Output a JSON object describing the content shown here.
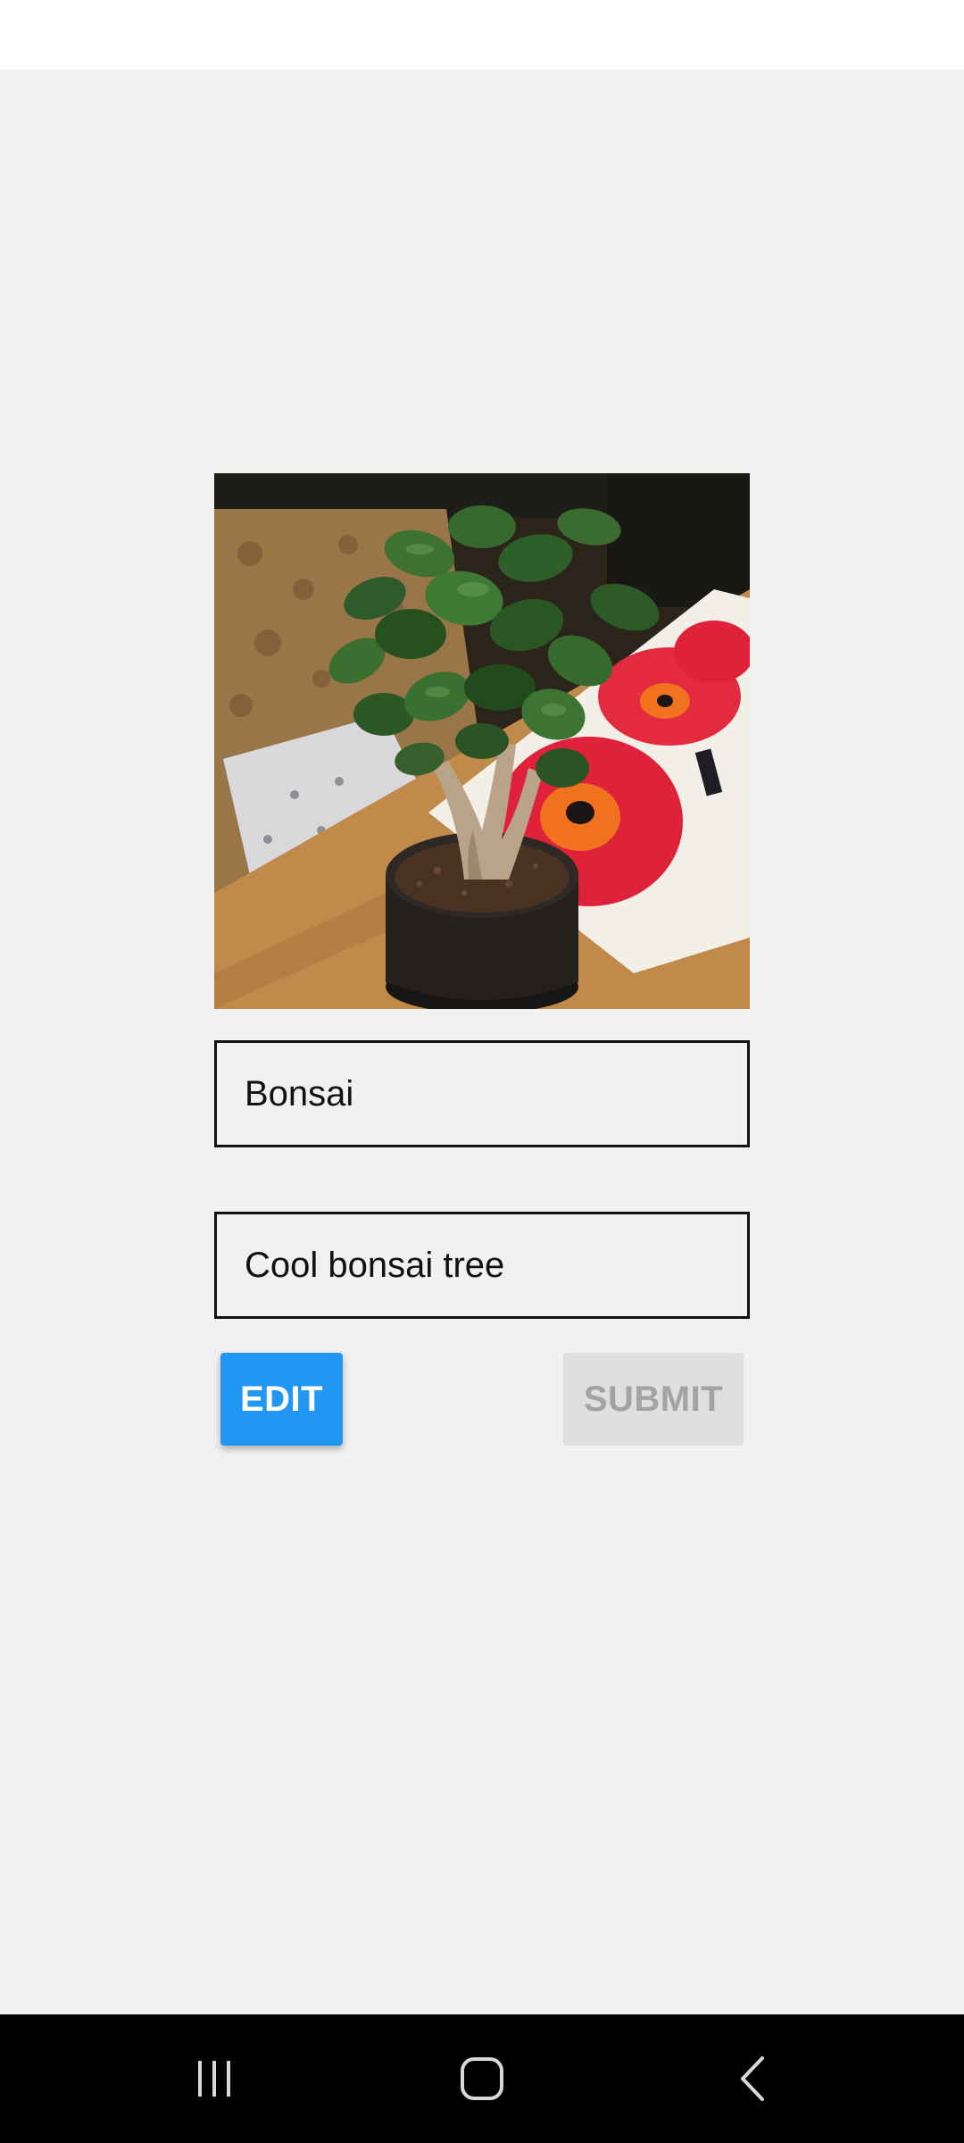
{
  "item": {
    "title_value": "Bonsai",
    "description_value": "Cool bonsai tree"
  },
  "actions": {
    "edit_label": "EDIT",
    "submit_label": "SUBMIT"
  },
  "colors": {
    "edit_button": "#2196f3",
    "submit_disabled": "#dfdfdf",
    "background": "#f1f1f1"
  },
  "icons": {
    "nav_recents": "recents-icon",
    "nav_home": "home-icon",
    "nav_back": "back-icon"
  }
}
